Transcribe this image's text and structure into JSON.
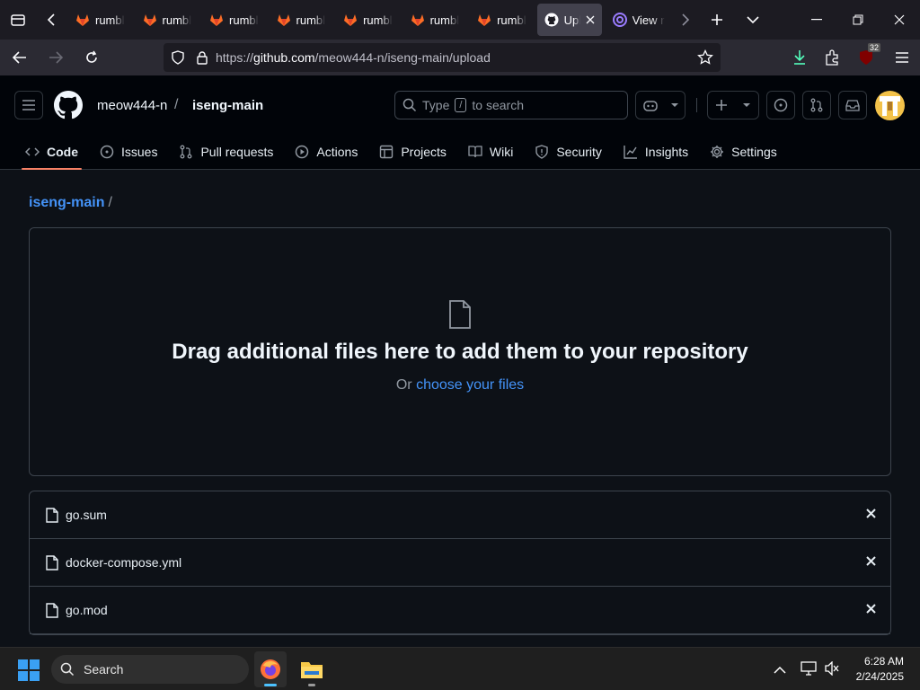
{
  "browser": {
    "tabs": [
      {
        "label": "rumbl",
        "icon": "gitlab-icon"
      },
      {
        "label": "rumbl",
        "icon": "gitlab-icon"
      },
      {
        "label": "rumbl",
        "icon": "gitlab-icon"
      },
      {
        "label": "rumbl",
        "icon": "gitlab-icon"
      },
      {
        "label": "rumbl",
        "icon": "gitlab-icon"
      },
      {
        "label": "rumbl",
        "icon": "gitlab-icon"
      },
      {
        "label": "rumbl",
        "icon": "gitlab-icon"
      },
      {
        "label": "Upl",
        "icon": "github-icon",
        "active": true
      },
      {
        "label": "View r",
        "icon": "tor-icon"
      }
    ],
    "url": "https://github.com/meow444-n/iseng-main/upload",
    "url_host": "github.com",
    "extension_badge": "32"
  },
  "github": {
    "owner": "meow444-n",
    "separator": "/",
    "repo": "iseng-main",
    "search_prefix": "Type",
    "search_key": "/",
    "search_suffix": "to search",
    "nav": [
      {
        "label": "Code",
        "icon": "code-icon",
        "selected": true
      },
      {
        "label": "Issues",
        "icon": "issue-icon"
      },
      {
        "label": "Pull requests",
        "icon": "pull-request-icon"
      },
      {
        "label": "Actions",
        "icon": "play-icon"
      },
      {
        "label": "Projects",
        "icon": "table-icon"
      },
      {
        "label": "Wiki",
        "icon": "book-icon"
      },
      {
        "label": "Security",
        "icon": "shield-icon"
      },
      {
        "label": "Insights",
        "icon": "graph-icon"
      },
      {
        "label": "Settings",
        "icon": "gear-icon"
      }
    ]
  },
  "upload": {
    "breadcrumb_repo": "iseng-main",
    "breadcrumb_sep": "/",
    "title": "Drag additional files here to add them to your repository",
    "sub_prefix": "Or",
    "sub_link": "choose your files",
    "files": [
      "go.sum",
      "docker-compose.yml",
      "go.mod"
    ]
  },
  "taskbar": {
    "search": "Search",
    "time": "6:28 AM",
    "date": "2/24/2025"
  },
  "colors": {
    "accent_link": "#4493f8",
    "tab_underline": "#f78166",
    "page_bg": "#0d1117"
  }
}
